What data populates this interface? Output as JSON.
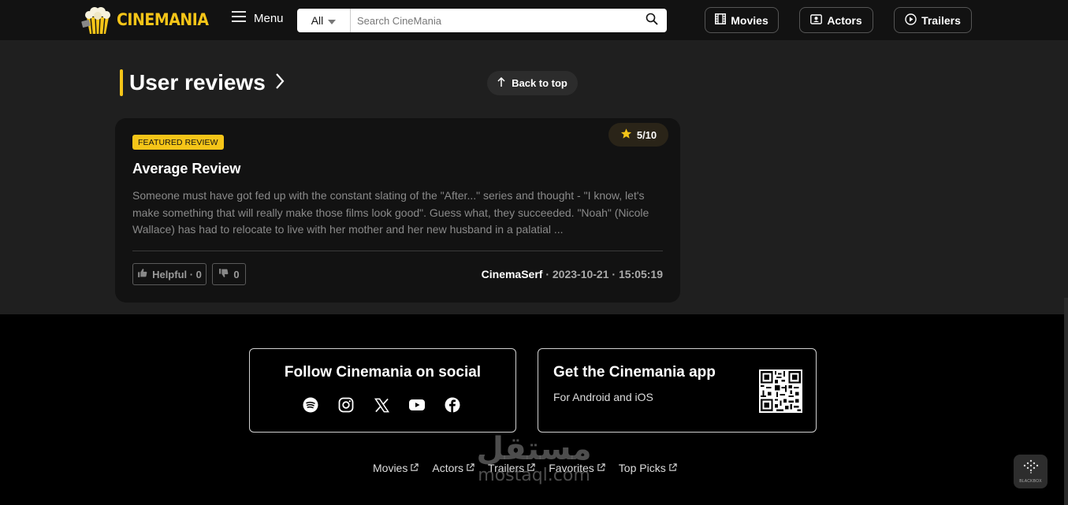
{
  "header": {
    "logo_text": "CINEMANIA",
    "menu_label": "Menu",
    "search": {
      "category": "All",
      "placeholder": "Search CineMania"
    },
    "nav": {
      "movies": "Movies",
      "actors": "Actors",
      "trailers": "Trailers"
    }
  },
  "section": {
    "title": "User reviews",
    "back_to_top": "Back to top"
  },
  "review": {
    "badge": "FEATURED REVIEW",
    "rating": "5/10",
    "title": "Average Review",
    "body": "Someone must have got fed up with the constant slating of the \"After...\" series and thought - \"I know, let's make something that will really make those films look good\". Guess what, they succeeded. \"Noah\" (Nicole Wallace) has had to relocate to live with her mother and her new husband in a palatial ...",
    "helpful_label": "Helpful · 0",
    "unhelpful_count": "0",
    "author": "CinemaSerf",
    "date_time": " · 2023-10-21 · 15:05:19"
  },
  "footer": {
    "social_title": "Follow Cinemania on social",
    "social_icons": [
      "spotify-icon",
      "instagram-icon",
      "x-icon",
      "youtube-icon",
      "facebook-icon"
    ],
    "app_title": "Get the Cinemania app",
    "app_subtitle": "For Android and iOS",
    "links": [
      "Movies",
      "Actors",
      "Trailers",
      "Favorites",
      "Top Picks"
    ]
  },
  "watermark": {
    "arabic": "مستقل",
    "latin": "mostaql.com"
  },
  "blackbox_label": "BLACKBOX",
  "colors": {
    "accent": "#f5c518",
    "header_bg": "#121212",
    "main_bg": "#1f1f1f",
    "card_bg": "#121212",
    "footer_bg": "#000000"
  }
}
